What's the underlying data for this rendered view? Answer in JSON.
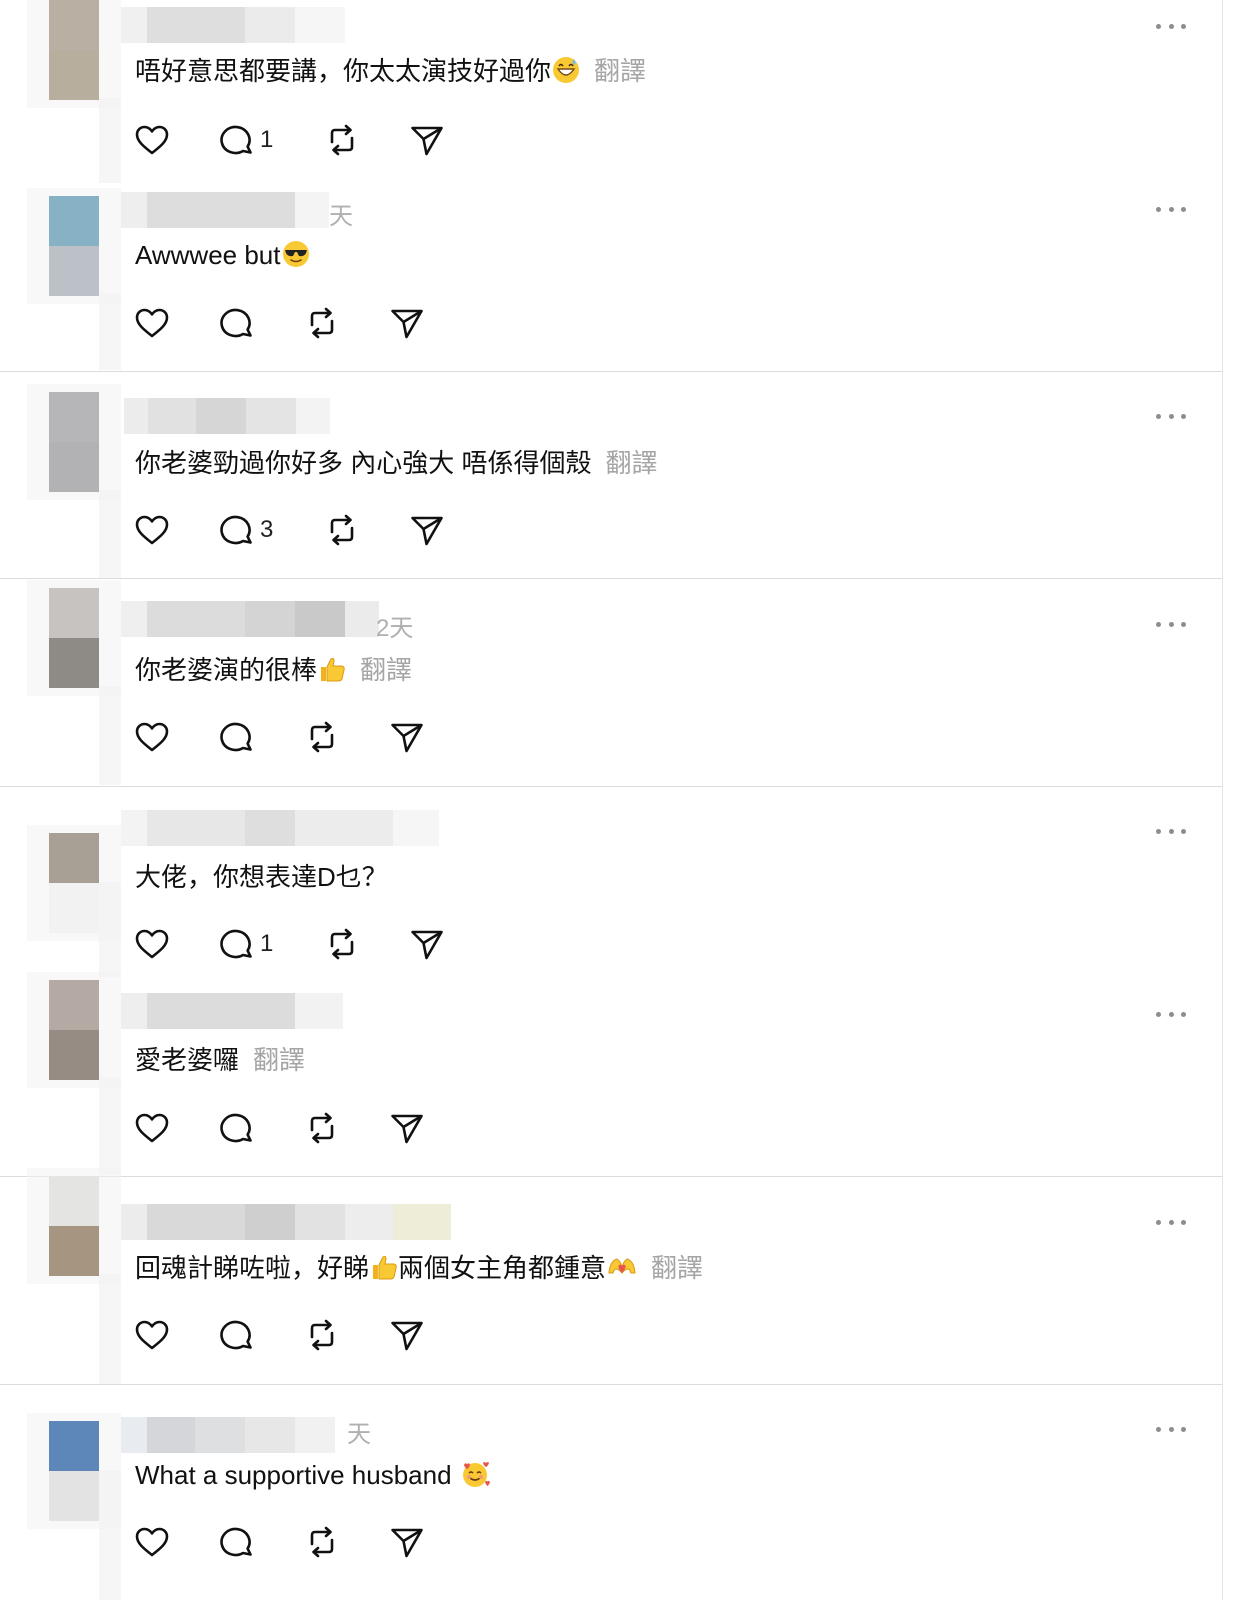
{
  "colors": {
    "text": "#111111",
    "muted": "#a5a5a5",
    "icon": "#111111",
    "separator": "#dcdcdc"
  },
  "comments": [
    {
      "timestamp": "",
      "text": "唔好意思都要講，你太太演技好過你",
      "emoji": "grinning-sweat",
      "translate": "翻譯",
      "reply_count": "1"
    },
    {
      "timestamp": "天",
      "text": "Awwwee but",
      "emoji": "sunglasses",
      "translate": "",
      "reply_count": ""
    },
    {
      "timestamp": "",
      "text": "你老婆勁過你好多 內心強大 唔係得個殼",
      "emoji": "",
      "translate": "翻譯",
      "reply_count": "3"
    },
    {
      "timestamp": "2天",
      "text": "你老婆演的很棒",
      "emoji": "thumbs-up",
      "translate": "翻譯",
      "reply_count": ""
    },
    {
      "timestamp": "",
      "text": "大佬，你想表達D乜？",
      "emoji": "",
      "translate": "",
      "reply_count": "1"
    },
    {
      "timestamp": "",
      "text": "愛老婆囉",
      "emoji": "",
      "translate": "翻譯",
      "reply_count": ""
    },
    {
      "timestamp": "",
      "text": "回魂計睇咗啦，好睇",
      "text_after_emoji": "兩個女主角都鍾意",
      "emoji": "thumbs-up",
      "emoji2": "heart-hands",
      "translate": "翻譯",
      "reply_count": ""
    },
    {
      "timestamp": "天",
      "text": "What a supportive husband ",
      "emoji": "smiling-with-hearts",
      "translate": "",
      "reply_count": ""
    }
  ],
  "action_icons": [
    "heart-icon",
    "comment-icon",
    "repost-icon",
    "share-icon"
  ],
  "more_icon": "more-horizontal-icon"
}
